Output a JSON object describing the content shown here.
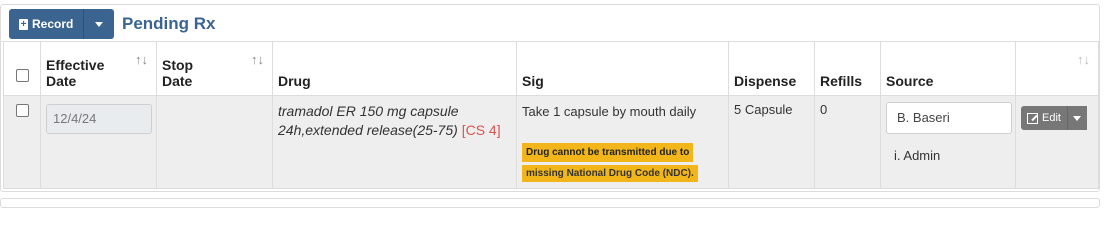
{
  "header": {
    "record_button_label": "Record",
    "title": "Pending Rx"
  },
  "table": {
    "columns": [
      {
        "label": "",
        "sortable": false
      },
      {
        "label": "Effective Date",
        "line1": "Effective",
        "line2": "Date",
        "sort_icon": "sort-icon"
      },
      {
        "label": "Stop Date",
        "line1": "Stop",
        "line2": "Date",
        "sort_icon": "sort-icon"
      },
      {
        "label": "Drug"
      },
      {
        "label": "Sig"
      },
      {
        "label": "Dispense"
      },
      {
        "label": "Refills"
      },
      {
        "label": "Source"
      },
      {
        "label": "",
        "sort_icon": "sort-icon"
      }
    ],
    "rows": [
      {
        "effective_date": "12/4/24",
        "stop_date": "",
        "drug_line1": "tramadol ER 150 mg capsule",
        "drug_line2": "24h,extended release(25-75)",
        "drug_schedule": "[CS 4]",
        "sig": "Take 1 capsule by mouth daily",
        "warning_line1": "Drug cannot be transmitted due to",
        "warning_line2": "missing National Drug Code (NDC).",
        "dispense": "5 Capsule",
        "refills": "0",
        "source_provider": "B. Baseri",
        "source_user": "i. Admin",
        "edit_label": "Edit"
      }
    ]
  },
  "colors": {
    "primary": "#3b6590",
    "warning": "#f2b61a",
    "controlled": "#d9534f",
    "edit_button": "#777777"
  }
}
